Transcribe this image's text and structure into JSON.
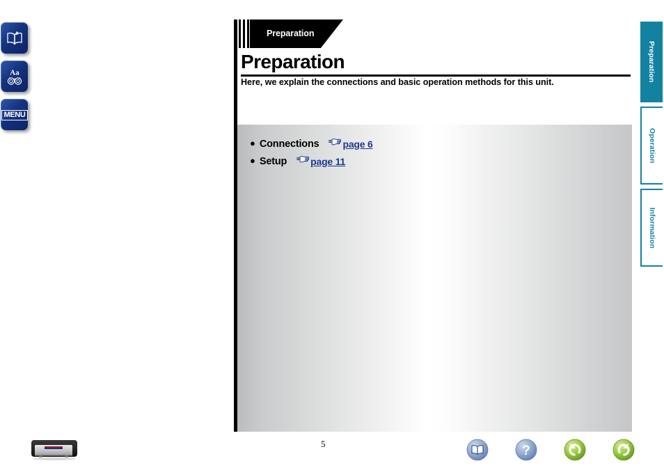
{
  "document": {
    "title": "Preparation",
    "banner_label": "Preparation",
    "lead_text": "Here, we explain the connections and basic operation methods for this unit.",
    "page_number": "5"
  },
  "left_nav": {
    "items": [
      {
        "icon": "open-book-icon",
        "name": "contents-button",
        "label": "Contents"
      },
      {
        "icon": "search-binoculars-icon",
        "name": "search-button",
        "label": "Aa"
      },
      {
        "icon": "menu-icon",
        "name": "menu-button",
        "label": "MENU"
      }
    ]
  },
  "toc": {
    "items": [
      {
        "bullet": "●",
        "label": "Connections",
        "link_icon": "pointing-hand-icon",
        "link_text": "page 6"
      },
      {
        "bullet": "●",
        "label": "Setup",
        "link_icon": "pointing-hand-icon",
        "link_text": "page 11"
      }
    ]
  },
  "side_tabs": {
    "items": [
      {
        "label": "Preparation",
        "active": true
      },
      {
        "label": "Operation",
        "active": false
      },
      {
        "label": "Information",
        "active": false
      }
    ]
  },
  "footer": {
    "tools": [
      {
        "icon": "book-contents-icon",
        "name": "contents-tool"
      },
      {
        "icon": "question-help-icon",
        "name": "help-tool"
      },
      {
        "icon": "back-arrow-icon",
        "name": "back-tool"
      },
      {
        "icon": "forward-arrow-icon",
        "name": "forward-tool"
      }
    ]
  },
  "colors": {
    "accent_teal": "#1382a0",
    "link_blue": "#1a3a90",
    "nav_blue": "#14337e",
    "tool_green": "#8cc63f",
    "tool_blue": "#7d9dc8"
  },
  "product": {
    "name": "av-receiver-image"
  }
}
